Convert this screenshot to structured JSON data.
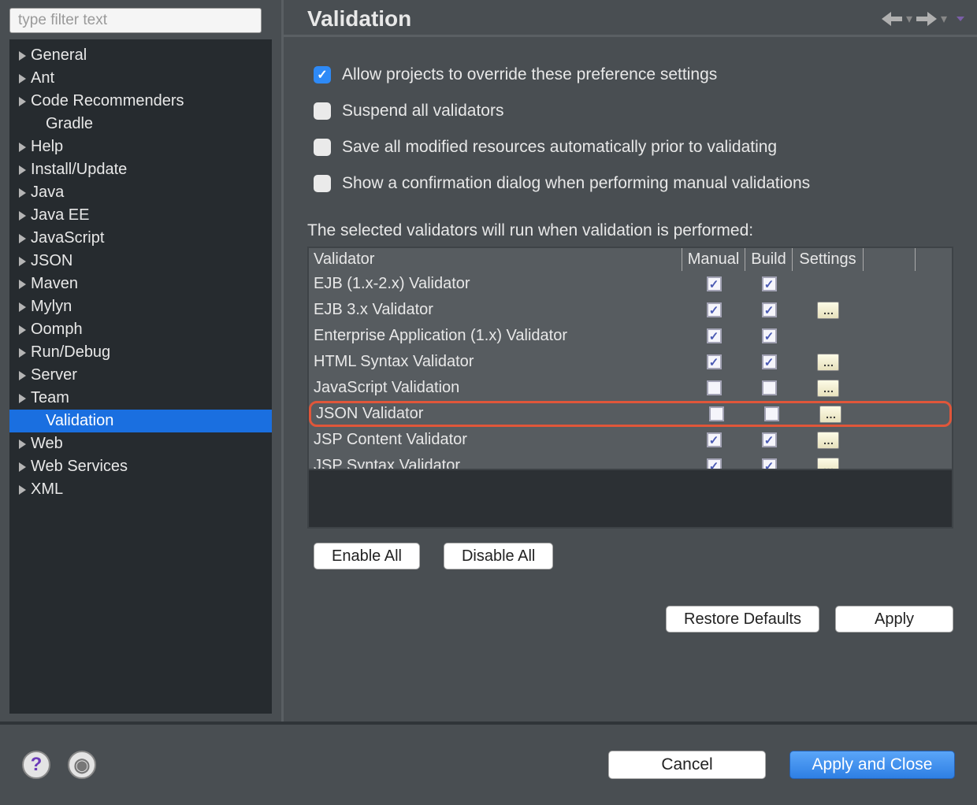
{
  "filter": {
    "placeholder": "type filter text"
  },
  "sidebar": {
    "items": [
      {
        "label": "General",
        "expandable": true
      },
      {
        "label": "Ant",
        "expandable": true
      },
      {
        "label": "Code Recommenders",
        "expandable": true
      },
      {
        "label": "Gradle",
        "expandable": false,
        "child": true
      },
      {
        "label": "Help",
        "expandable": true
      },
      {
        "label": "Install/Update",
        "expandable": true
      },
      {
        "label": "Java",
        "expandable": true
      },
      {
        "label": "Java EE",
        "expandable": true
      },
      {
        "label": "JavaScript",
        "expandable": true
      },
      {
        "label": "JSON",
        "expandable": true
      },
      {
        "label": "Maven",
        "expandable": true
      },
      {
        "label": "Mylyn",
        "expandable": true
      },
      {
        "label": "Oomph",
        "expandable": true
      },
      {
        "label": "Run/Debug",
        "expandable": true
      },
      {
        "label": "Server",
        "expandable": true
      },
      {
        "label": "Team",
        "expandable": true
      },
      {
        "label": "Validation",
        "expandable": false,
        "child": true,
        "selected": true
      },
      {
        "label": "Web",
        "expandable": true
      },
      {
        "label": "Web Services",
        "expandable": true
      },
      {
        "label": "XML",
        "expandable": true
      }
    ]
  },
  "page": {
    "title": "Validation",
    "checks": [
      {
        "label": "Allow projects to override these preference settings",
        "checked": true
      },
      {
        "label": "Suspend all validators",
        "checked": false
      },
      {
        "label": "Save all modified resources automatically prior to validating",
        "checked": false
      },
      {
        "label": "Show a confirmation dialog when performing manual validations",
        "checked": false
      }
    ],
    "table_label": "The selected validators will run when validation is performed:",
    "columns": {
      "c0": "Validator",
      "c1": "Manual",
      "c2": "Build",
      "c3": "Settings"
    },
    "rows": [
      {
        "name": "EJB (1.x-2.x) Validator",
        "manual": true,
        "build": true,
        "settings": false
      },
      {
        "name": "EJB 3.x Validator",
        "manual": true,
        "build": true,
        "settings": true
      },
      {
        "name": "Enterprise Application (1.x) Validator",
        "manual": true,
        "build": true,
        "settings": false
      },
      {
        "name": "HTML Syntax Validator",
        "manual": true,
        "build": true,
        "settings": true
      },
      {
        "name": "JavaScript Validation",
        "manual": false,
        "build": false,
        "settings": true
      },
      {
        "name": "JSON Validator",
        "manual": false,
        "build": false,
        "settings": true,
        "highlight": true
      },
      {
        "name": "JSP Content Validator",
        "manual": true,
        "build": true,
        "settings": true
      },
      {
        "name": "JSP Syntax Validator",
        "manual": true,
        "build": true,
        "settings": true
      }
    ],
    "enable_all": "Enable All",
    "disable_all": "Disable All",
    "restore": "Restore Defaults",
    "apply": "Apply"
  },
  "footer": {
    "cancel": "Cancel",
    "apply_close": "Apply and Close"
  }
}
